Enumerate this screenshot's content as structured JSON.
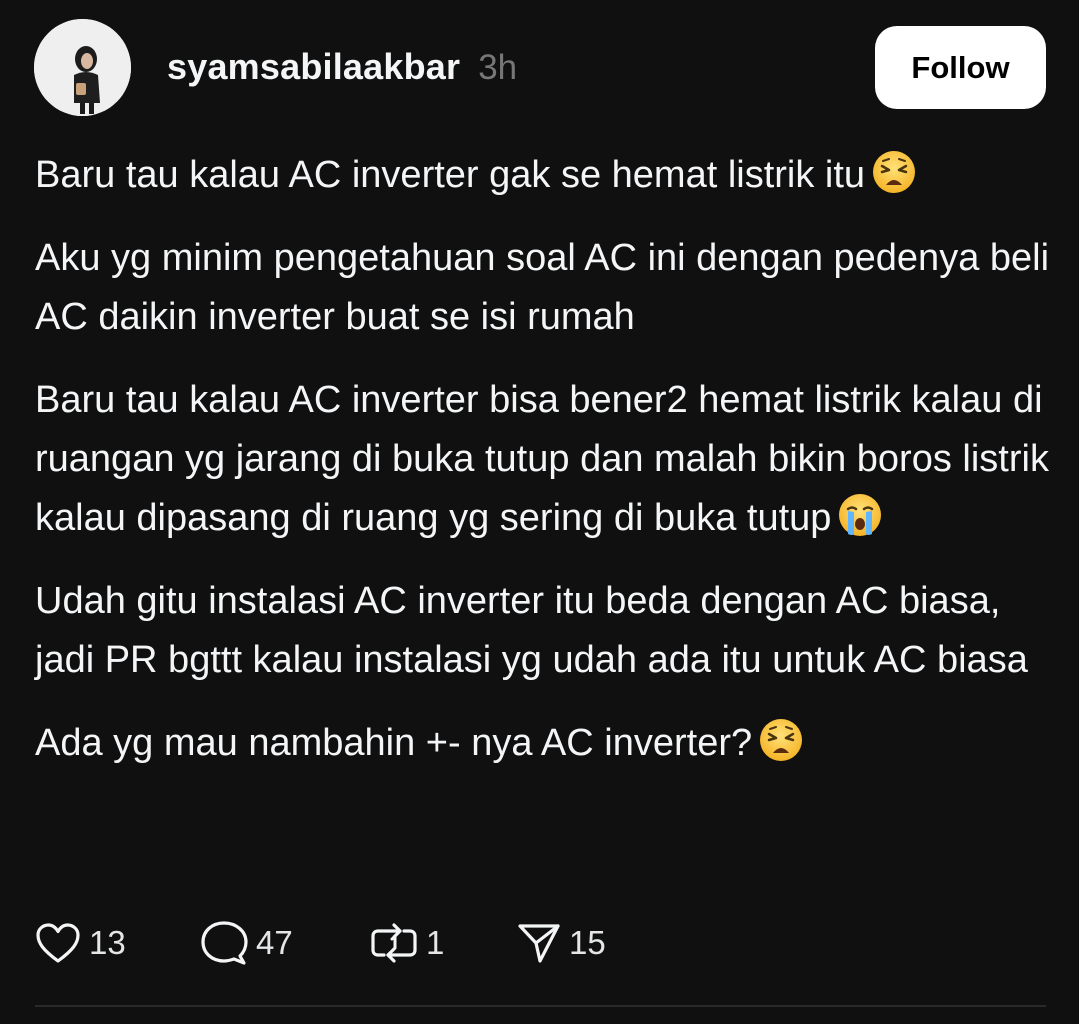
{
  "post": {
    "username": "syamsabilaakbar",
    "timestamp": "3h",
    "follow_label": "Follow",
    "paragraphs": [
      {
        "text": "Baru tau kalau AC inverter gak se hemat listrik itu",
        "emoji": "weary-face"
      },
      {
        "text": "Aku yg minim pengetahuan soal AC ini dengan pedenya beli AC daikin inverter buat se isi rumah",
        "emoji": null
      },
      {
        "text": "Baru tau kalau AC inverter bisa bener2 hemat listrik kalau di ruangan yg jarang di buka tutup dan malah bikin boros listrik kalau dipasang di ruang yg sering di buka tutup",
        "emoji": "crying-face"
      },
      {
        "text": "Udah gitu instalasi AC inverter itu beda dengan AC biasa, jadi PR bgttt kalau instalasi yg udah ada itu untuk AC biasa",
        "emoji": null
      },
      {
        "text": "Ada yg mau nambahin +- nya AC inverter?",
        "emoji": "weary-face"
      }
    ],
    "actions": {
      "likes": "13",
      "comments": "47",
      "reposts": "1",
      "shares": "15"
    }
  },
  "icons": {
    "like": "heart-icon",
    "comment": "comment-bubble-icon",
    "repost": "repost-icon",
    "share": "send-icon"
  },
  "colors": {
    "background": "#101010",
    "text": "#f3f5f7",
    "muted": "#777777",
    "button_bg": "#ffffff"
  }
}
